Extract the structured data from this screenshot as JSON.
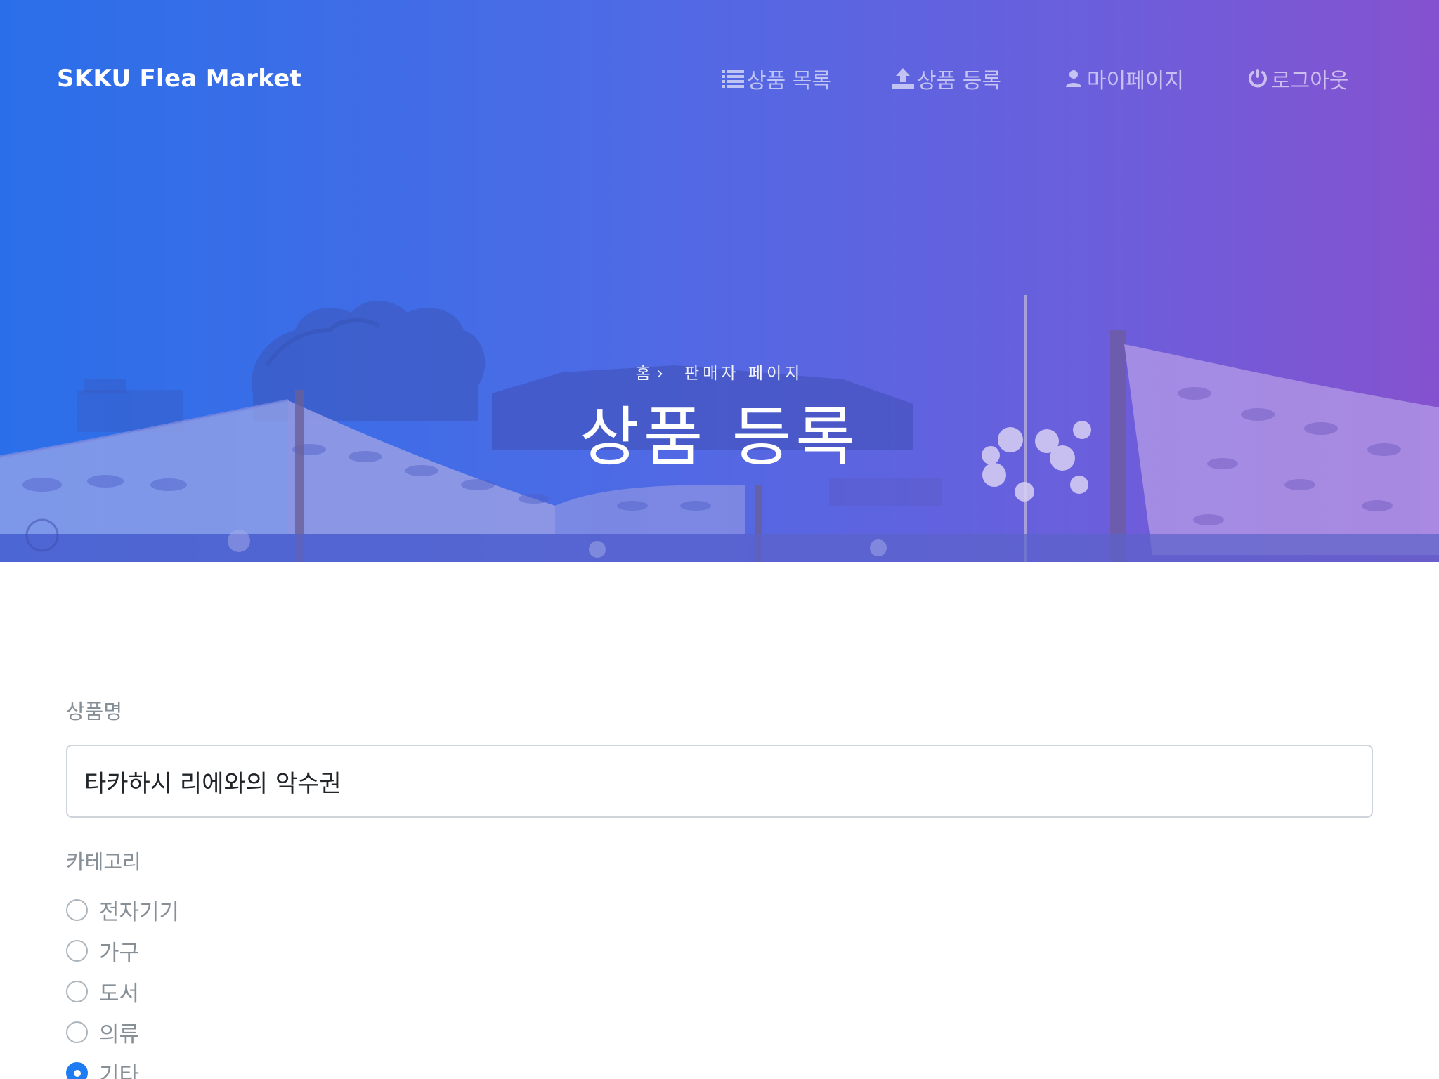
{
  "navbar": {
    "brand": "SKKU Flea Market",
    "items": [
      {
        "label": "상품 목록",
        "icon": "list-icon"
      },
      {
        "label": "상품 등록",
        "icon": "upload-icon"
      },
      {
        "label": "마이페이지",
        "icon": "user-icon"
      },
      {
        "label": "로그아웃",
        "icon": "power-icon"
      }
    ]
  },
  "hero": {
    "breadcrumb": {
      "home": "홈",
      "current": "판매자 페이지"
    },
    "title": "상품 등록"
  },
  "form": {
    "name_label": "상품명",
    "name_value": "타카하시 리에와의 악수권",
    "category_label": "카테고리",
    "categories": [
      {
        "label": "전자기기",
        "checked": false
      },
      {
        "label": "가구",
        "checked": false
      },
      {
        "label": "도서",
        "checked": false
      },
      {
        "label": "의류",
        "checked": false
      },
      {
        "label": "기타",
        "checked": true
      }
    ]
  },
  "colors": {
    "hero_gradient_start": "#2a6fe9",
    "hero_gradient_end": "#8552cf",
    "radio_checked": "#1d7cf2"
  }
}
